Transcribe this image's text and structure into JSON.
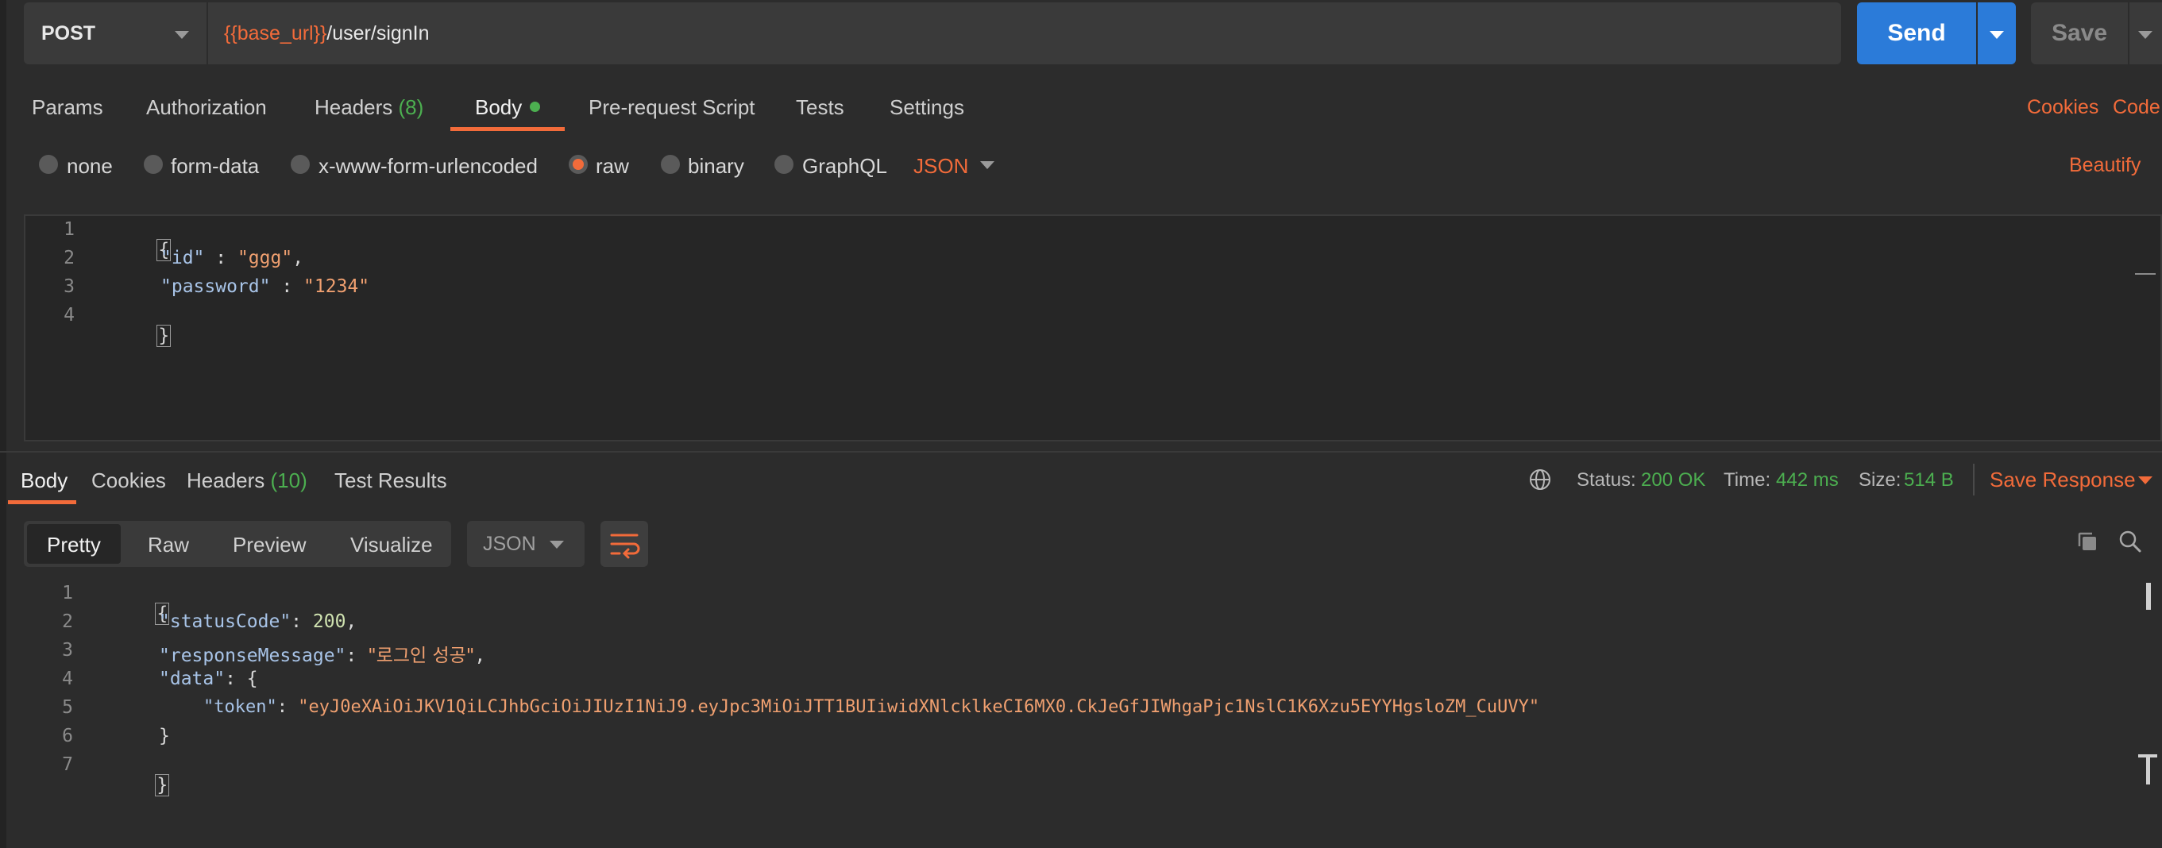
{
  "request": {
    "method": "POST",
    "url_variable": "{{base_url}}",
    "url_path": "/user/signIn",
    "send_label": "Send",
    "save_label": "Save"
  },
  "request_tabs": {
    "params": "Params",
    "authorization": "Authorization",
    "headers": "Headers",
    "headers_count": "(8)",
    "body": "Body",
    "pre_request": "Pre-request Script",
    "tests": "Tests",
    "settings": "Settings",
    "cookies": "Cookies",
    "code": "Code"
  },
  "body_types": {
    "none": "none",
    "form_data": "form-data",
    "urlencoded": "x-www-form-urlencoded",
    "raw": "raw",
    "binary": "binary",
    "graphql": "GraphQL",
    "selected": "raw",
    "raw_format": "JSON",
    "beautify": "Beautify"
  },
  "request_body": {
    "line_numbers": [
      "1",
      "2",
      "3",
      "4"
    ],
    "open_brace": "{",
    "id_key": "\"id\"",
    "id_value": "\"ggg\"",
    "password_key": "\"password\"",
    "password_value": "\"1234\"",
    "close_brace": "}"
  },
  "response_tabs": {
    "body": "Body",
    "cookies": "Cookies",
    "headers": "Headers",
    "headers_count": "(10)",
    "test_results": "Test Results"
  },
  "response_meta": {
    "status_label": "Status:",
    "status_value": "200 OK",
    "time_label": "Time:",
    "time_value": "442 ms",
    "size_label": "Size:",
    "size_value": "514 B",
    "save_response": "Save Response"
  },
  "response_view": {
    "pretty": "Pretty",
    "raw": "Raw",
    "preview": "Preview",
    "visualize": "Visualize",
    "format": "JSON"
  },
  "response_body": {
    "line_numbers": [
      "1",
      "2",
      "3",
      "4",
      "5",
      "6",
      "7"
    ],
    "open_brace": "{",
    "status_key": "\"statusCode\"",
    "status_value": "200",
    "message_key": "\"responseMessage\"",
    "message_value": "\"로그인 성공\"",
    "data_key": "\"data\"",
    "token_key": "\"token\"",
    "token_value": "\"eyJ0eXAiOiJKV1QiLCJhbGciOiJIUzI1NiJ9.eyJpc3MiOiJTT1BUIiwidXNlcklkeCI6MX0.CkJeGfJIWhgaPjc1NslC1K6Xzu5EYYHgsloZM_CuUVY\"",
    "inner_close": "}",
    "close_brace": "}"
  },
  "colors": {
    "accent": "#f26b3a",
    "send": "#2b7bd9",
    "success": "#4caf50",
    "background": "#2c2c2c"
  }
}
